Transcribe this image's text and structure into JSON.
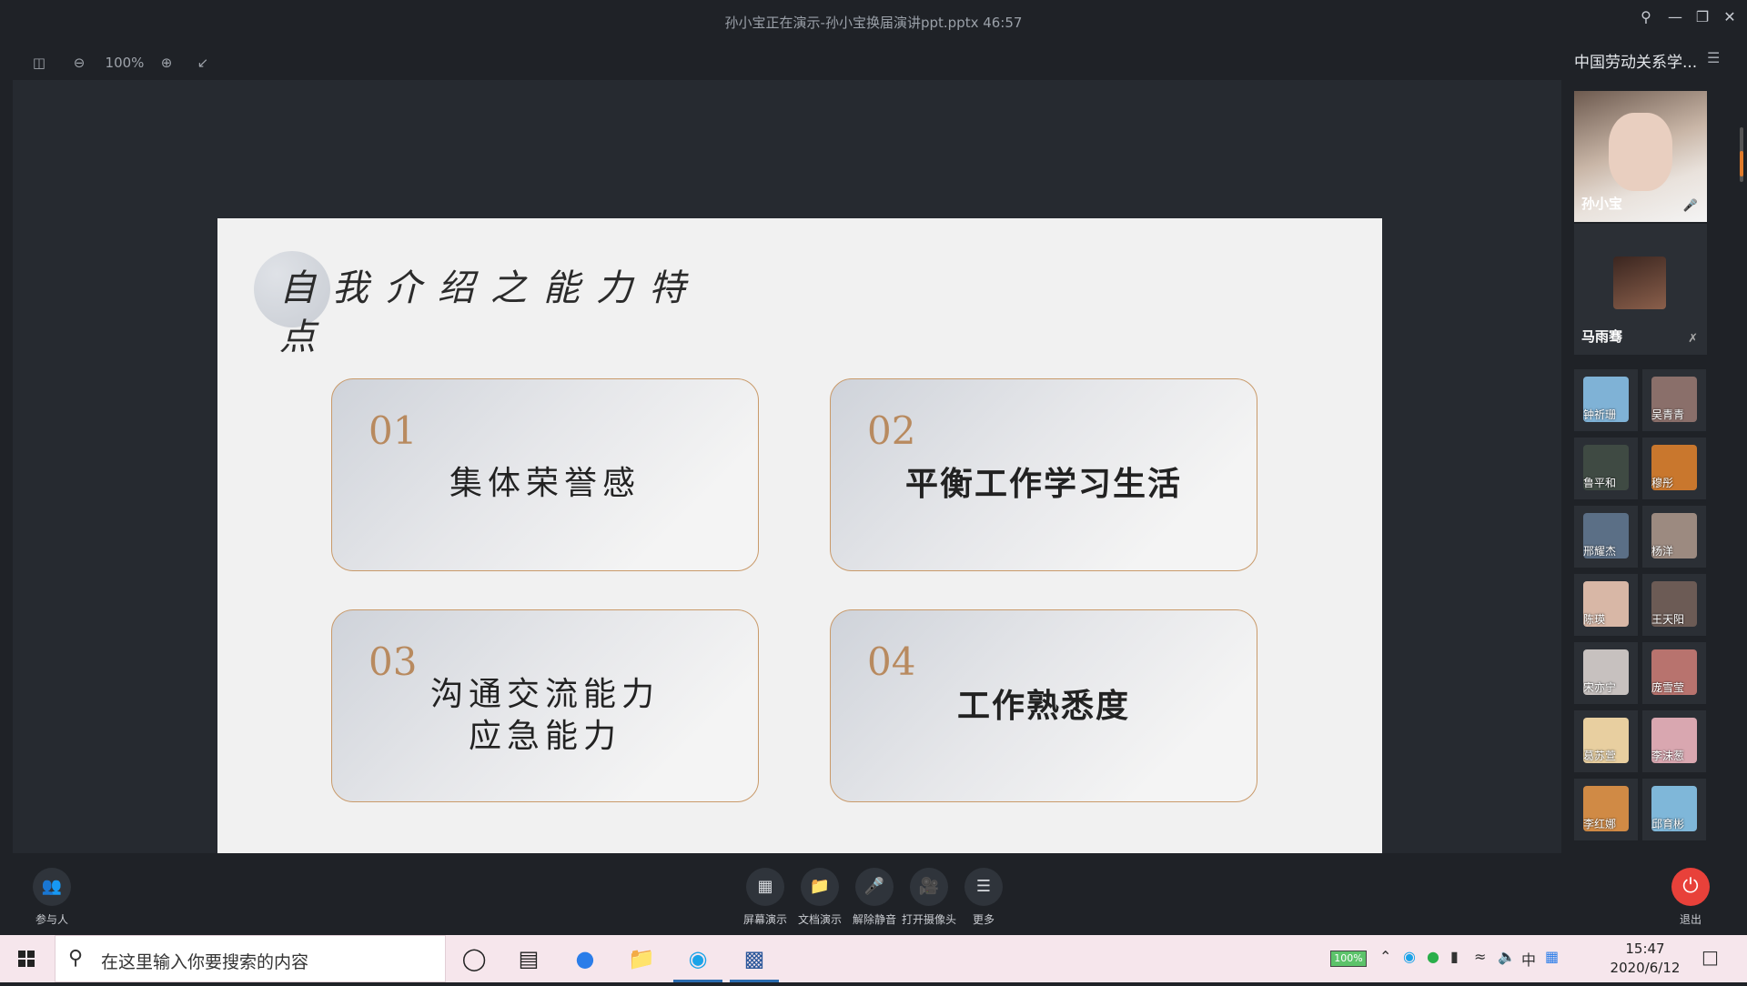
{
  "window": {
    "title": "孙小宝正在演示-孙小宝换届演讲ppt.pptx 46:57"
  },
  "toolbar": {
    "zoom": "100%"
  },
  "slide": {
    "title": "自我介绍之能力特点",
    "cards": [
      {
        "num": "01",
        "label": "集体荣誉感"
      },
      {
        "num": "02",
        "label": "平衡工作学习生活"
      },
      {
        "num": "03",
        "label_line1": "沟通交流能力",
        "label_line2": "应急能力"
      },
      {
        "num": "04",
        "label": "工作熟悉度"
      }
    ]
  },
  "panel": {
    "meeting_name": "中国劳动关系学...",
    "speakers": [
      {
        "name": "孙小宝"
      },
      {
        "name": "马雨骞"
      }
    ],
    "participants": [
      {
        "name": "钟祈珊",
        "color": "#7fb2d6"
      },
      {
        "name": "吴青青",
        "color": "#8a6f6a"
      },
      {
        "name": "鲁平和",
        "color": "#3f4a43"
      },
      {
        "name": "穆彤",
        "color": "#c9772d"
      },
      {
        "name": "邢耀杰",
        "color": "#5b6f86"
      },
      {
        "name": "杨洋",
        "color": "#9c8a80"
      },
      {
        "name": "陈瑛",
        "color": "#d8b7a6"
      },
      {
        "name": "王天阳",
        "color": "#6c5b55"
      },
      {
        "name": "宋亦宁",
        "color": "#c7c1bf"
      },
      {
        "name": "庞雪莹",
        "color": "#b8736e"
      },
      {
        "name": "葛苏萱",
        "color": "#e8cfa0"
      },
      {
        "name": "李沫葱",
        "color": "#d9a7b0"
      },
      {
        "name": "李红娜",
        "color": "#d08a45"
      },
      {
        "name": "邱育彬",
        "color": "#7fb7d9"
      }
    ]
  },
  "bottombar": {
    "participants_label": "参与人",
    "screen_share": "屏幕演示",
    "doc_share": "文档演示",
    "unmute": "解除静音",
    "camera": "打开摄像头",
    "more": "更多",
    "exit": "退出"
  },
  "taskbar": {
    "search_placeholder": "在这里输入你要搜索的内容",
    "battery": "100%",
    "time": "15:47",
    "date": "2020/6/12"
  },
  "colors": {
    "card_border": "#c99a6a",
    "card_number": "#b88a5f",
    "exit_button": "#e8413a"
  }
}
